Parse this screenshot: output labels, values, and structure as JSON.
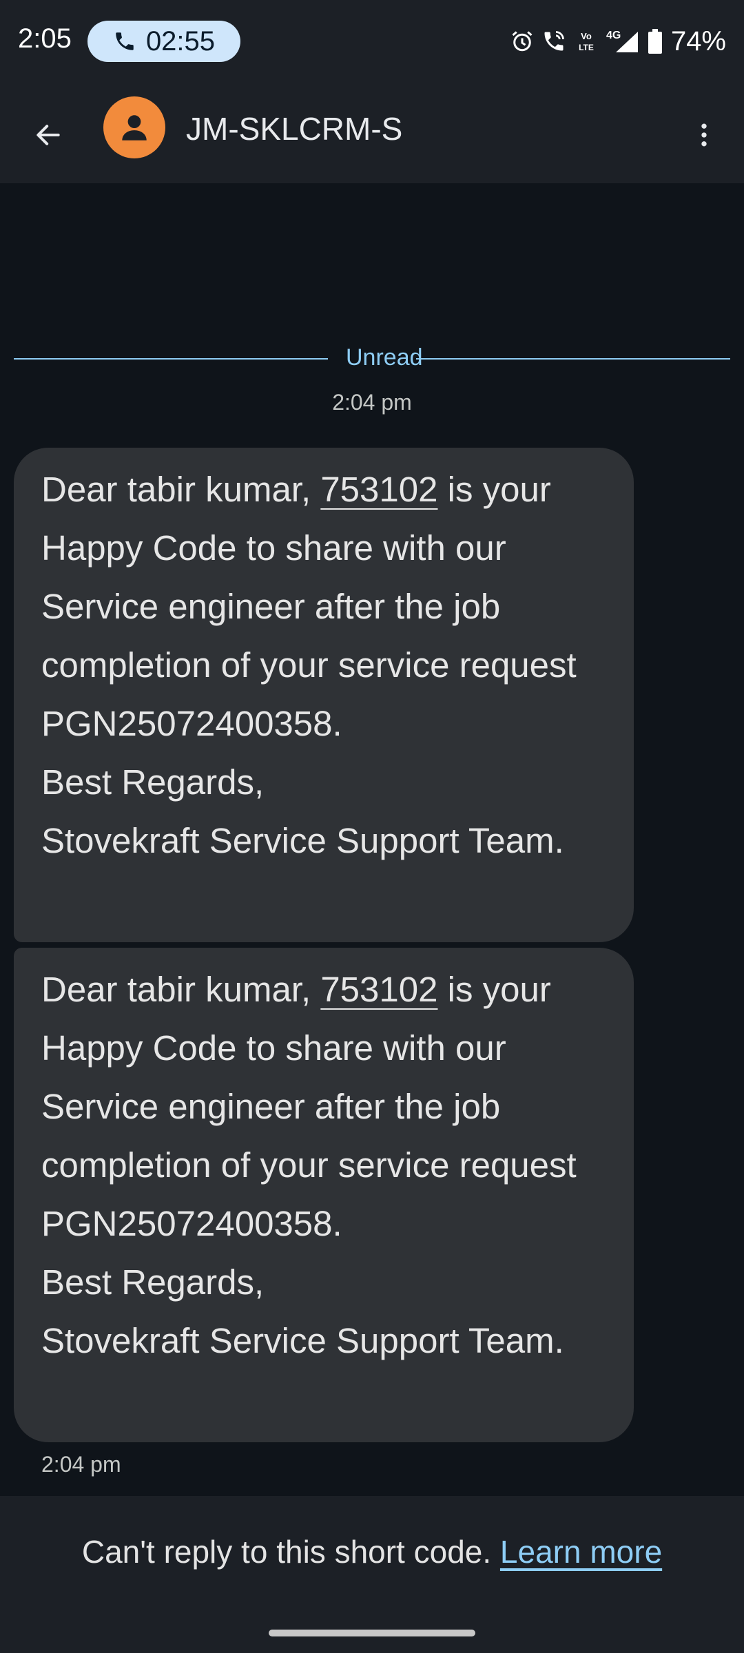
{
  "status_bar": {
    "time": "2:05",
    "call_timer": "02:55",
    "battery_percent": "74%",
    "network": "4G",
    "volte": "Vo LTE",
    "icons": [
      "alarm-icon",
      "wifi-call-icon",
      "volte-icon",
      "signal-icon",
      "battery-icon"
    ]
  },
  "header": {
    "contact_name": "JM-SKLCRM-S",
    "avatar_color": "#f28b3c"
  },
  "conversation": {
    "unread_label": "Unread",
    "timestamp_top": "2:04 pm",
    "messages": [
      {
        "prefix": "Dear tabir kumar, ",
        "code": "753102",
        "suffix": " is your Happy Code to share with our Service engineer after the job completion of your service request PGN25072400358.\nBest Regards,\nStovekraft Service Support Team."
      },
      {
        "prefix": "Dear tabir kumar, ",
        "code": "753102",
        "suffix": " is your Happy Code to share with our Service engineer after the job completion of your service request PGN25072400358.\nBest Regards,\nStovekraft Service Support Team."
      }
    ],
    "timestamp_bottom": "2:04 pm"
  },
  "footer": {
    "notice": "Can't reply to this short code.",
    "link_text": "Learn more"
  },
  "colors": {
    "accent": "#8ecdf5",
    "bubble": "#2f3236",
    "background": "#0f141a",
    "bar": "#1c2026"
  }
}
